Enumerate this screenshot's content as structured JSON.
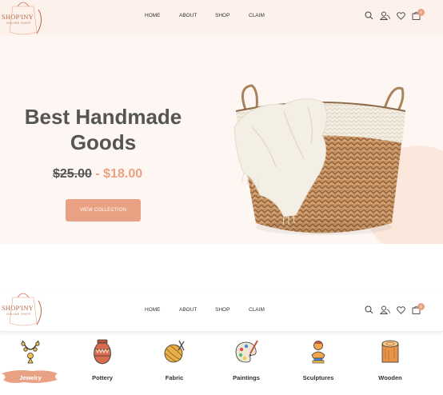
{
  "brand": {
    "name": "SHOP'INY",
    "tagline": "ONLINE SHOP"
  },
  "nav": {
    "items": [
      {
        "label": "HOME"
      },
      {
        "label": "ABOUT"
      },
      {
        "label": "SHOP"
      },
      {
        "label": "CLAIM"
      }
    ]
  },
  "header_icons": {
    "cart_count": "0",
    "icons": [
      "search-icon",
      "user-icon",
      "heart-icon",
      "cart-icon"
    ]
  },
  "hero": {
    "title_line1": "Best Handmade",
    "title_line2": "Goods",
    "old_price": "$25.00",
    "separator": "-",
    "new_price": "$18.00",
    "cta_label": "VIEW COLLECTION"
  },
  "categories": [
    {
      "label": "Jewelry",
      "icon": "necklace-icon",
      "active": true
    },
    {
      "label": "Pottery",
      "icon": "vase-icon"
    },
    {
      "label": "Fabric",
      "icon": "yarn-icon"
    },
    {
      "label": "Paintings",
      "icon": "palette-icon"
    },
    {
      "label": "Sculptures",
      "icon": "bust-icon"
    },
    {
      "label": "Wooden",
      "icon": "log-icon"
    }
  ],
  "colors": {
    "accent": "#e9a184",
    "brand": "#b9694a",
    "hero_bg": "#fdf6f2",
    "text_dark": "#555555"
  }
}
